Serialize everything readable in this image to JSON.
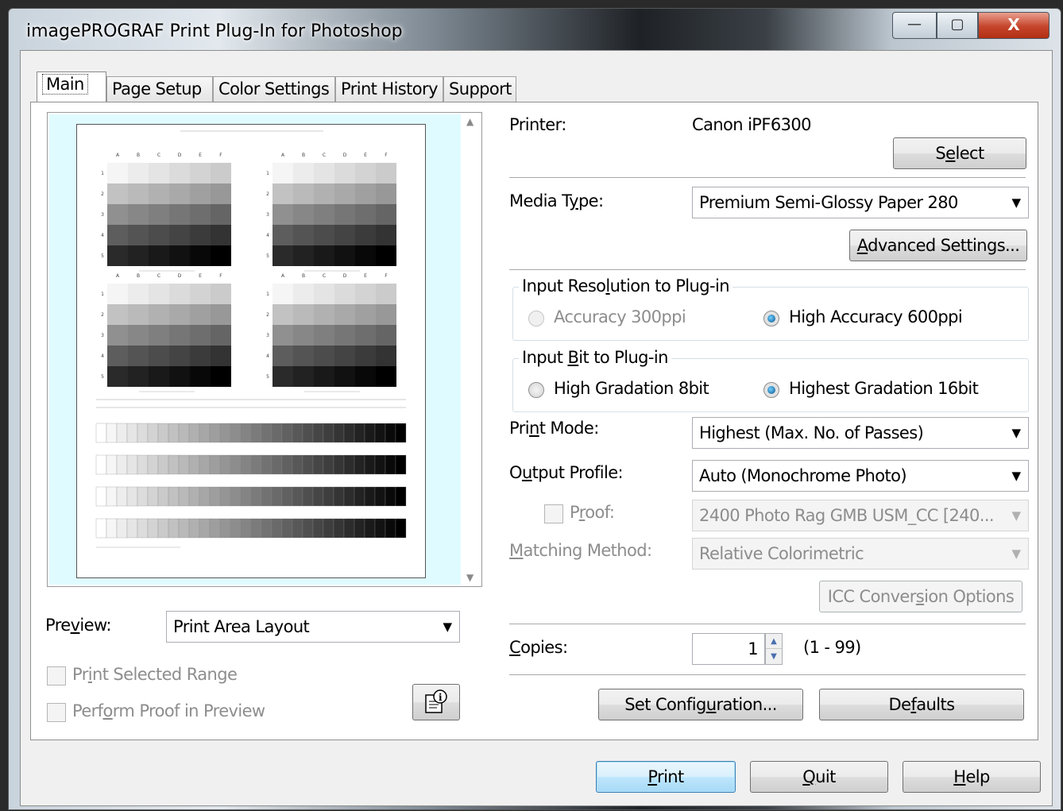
{
  "window": {
    "title": "imagePROGRAF Print Plug-In for Photoshop",
    "minimize": "—",
    "maximize": "▢",
    "close": "X"
  },
  "tabs": [
    {
      "label": "Main",
      "active": true
    },
    {
      "label": "Page Setup"
    },
    {
      "label": "Color Settings"
    },
    {
      "label": "Print History"
    },
    {
      "label": "Support"
    }
  ],
  "main": {
    "printer_label": "Printer:",
    "printer_value": "Canon iPF6300",
    "select_button": "Select",
    "media_type_label": "Media Type:",
    "media_type_value": "Premium Semi-Glossy Paper 280",
    "advanced_settings_button": "Advanced Settings...",
    "input_resolution": {
      "title": "Input Resolution to Plug-in",
      "option1": "Accuracy 300ppi",
      "option2": "High Accuracy 600ppi",
      "selected": "option2"
    },
    "input_bit": {
      "title": "Input Bit to Plug-in",
      "option1": "High Gradation 8bit",
      "option2": "Highest Gradation 16bit",
      "selected": "option2"
    },
    "print_mode_label": "Print Mode:",
    "print_mode_value": "Highest (Max. No. of Passes)",
    "output_profile_label": "Output Profile:",
    "output_profile_value": "Auto (Monochrome Photo)",
    "proof_label": "Proof:",
    "proof_profile_value": "2400 Photo Rag GMB USM_CC  [240...",
    "matching_method_label": "Matching Method:",
    "matching_method_value": "Relative Colorimetric",
    "icc_conversion_button": "ICC Conversion Options",
    "copies_label": "Copies:",
    "copies_value": "1",
    "copies_range": "(1 - 99)",
    "set_configuration_button": "Set Configuration...",
    "defaults_button": "Defaults"
  },
  "preview": {
    "label": "Preview:",
    "value": "Print Area Layout",
    "print_selected_range": "Print Selected Range",
    "perform_proof": "Perform Proof in Preview",
    "columns": [
      "A",
      "B",
      "C",
      "D",
      "E",
      "F"
    ],
    "rows": [
      "1",
      "2",
      "3",
      "4",
      "5"
    ]
  },
  "footer": {
    "print_button": "Print",
    "quit_button": "Quit",
    "help_button": "Help"
  },
  "colors": {
    "preview_background": "#e0fbff",
    "default_button_border": "#3c7fb1",
    "close_button": "#c5442b"
  }
}
